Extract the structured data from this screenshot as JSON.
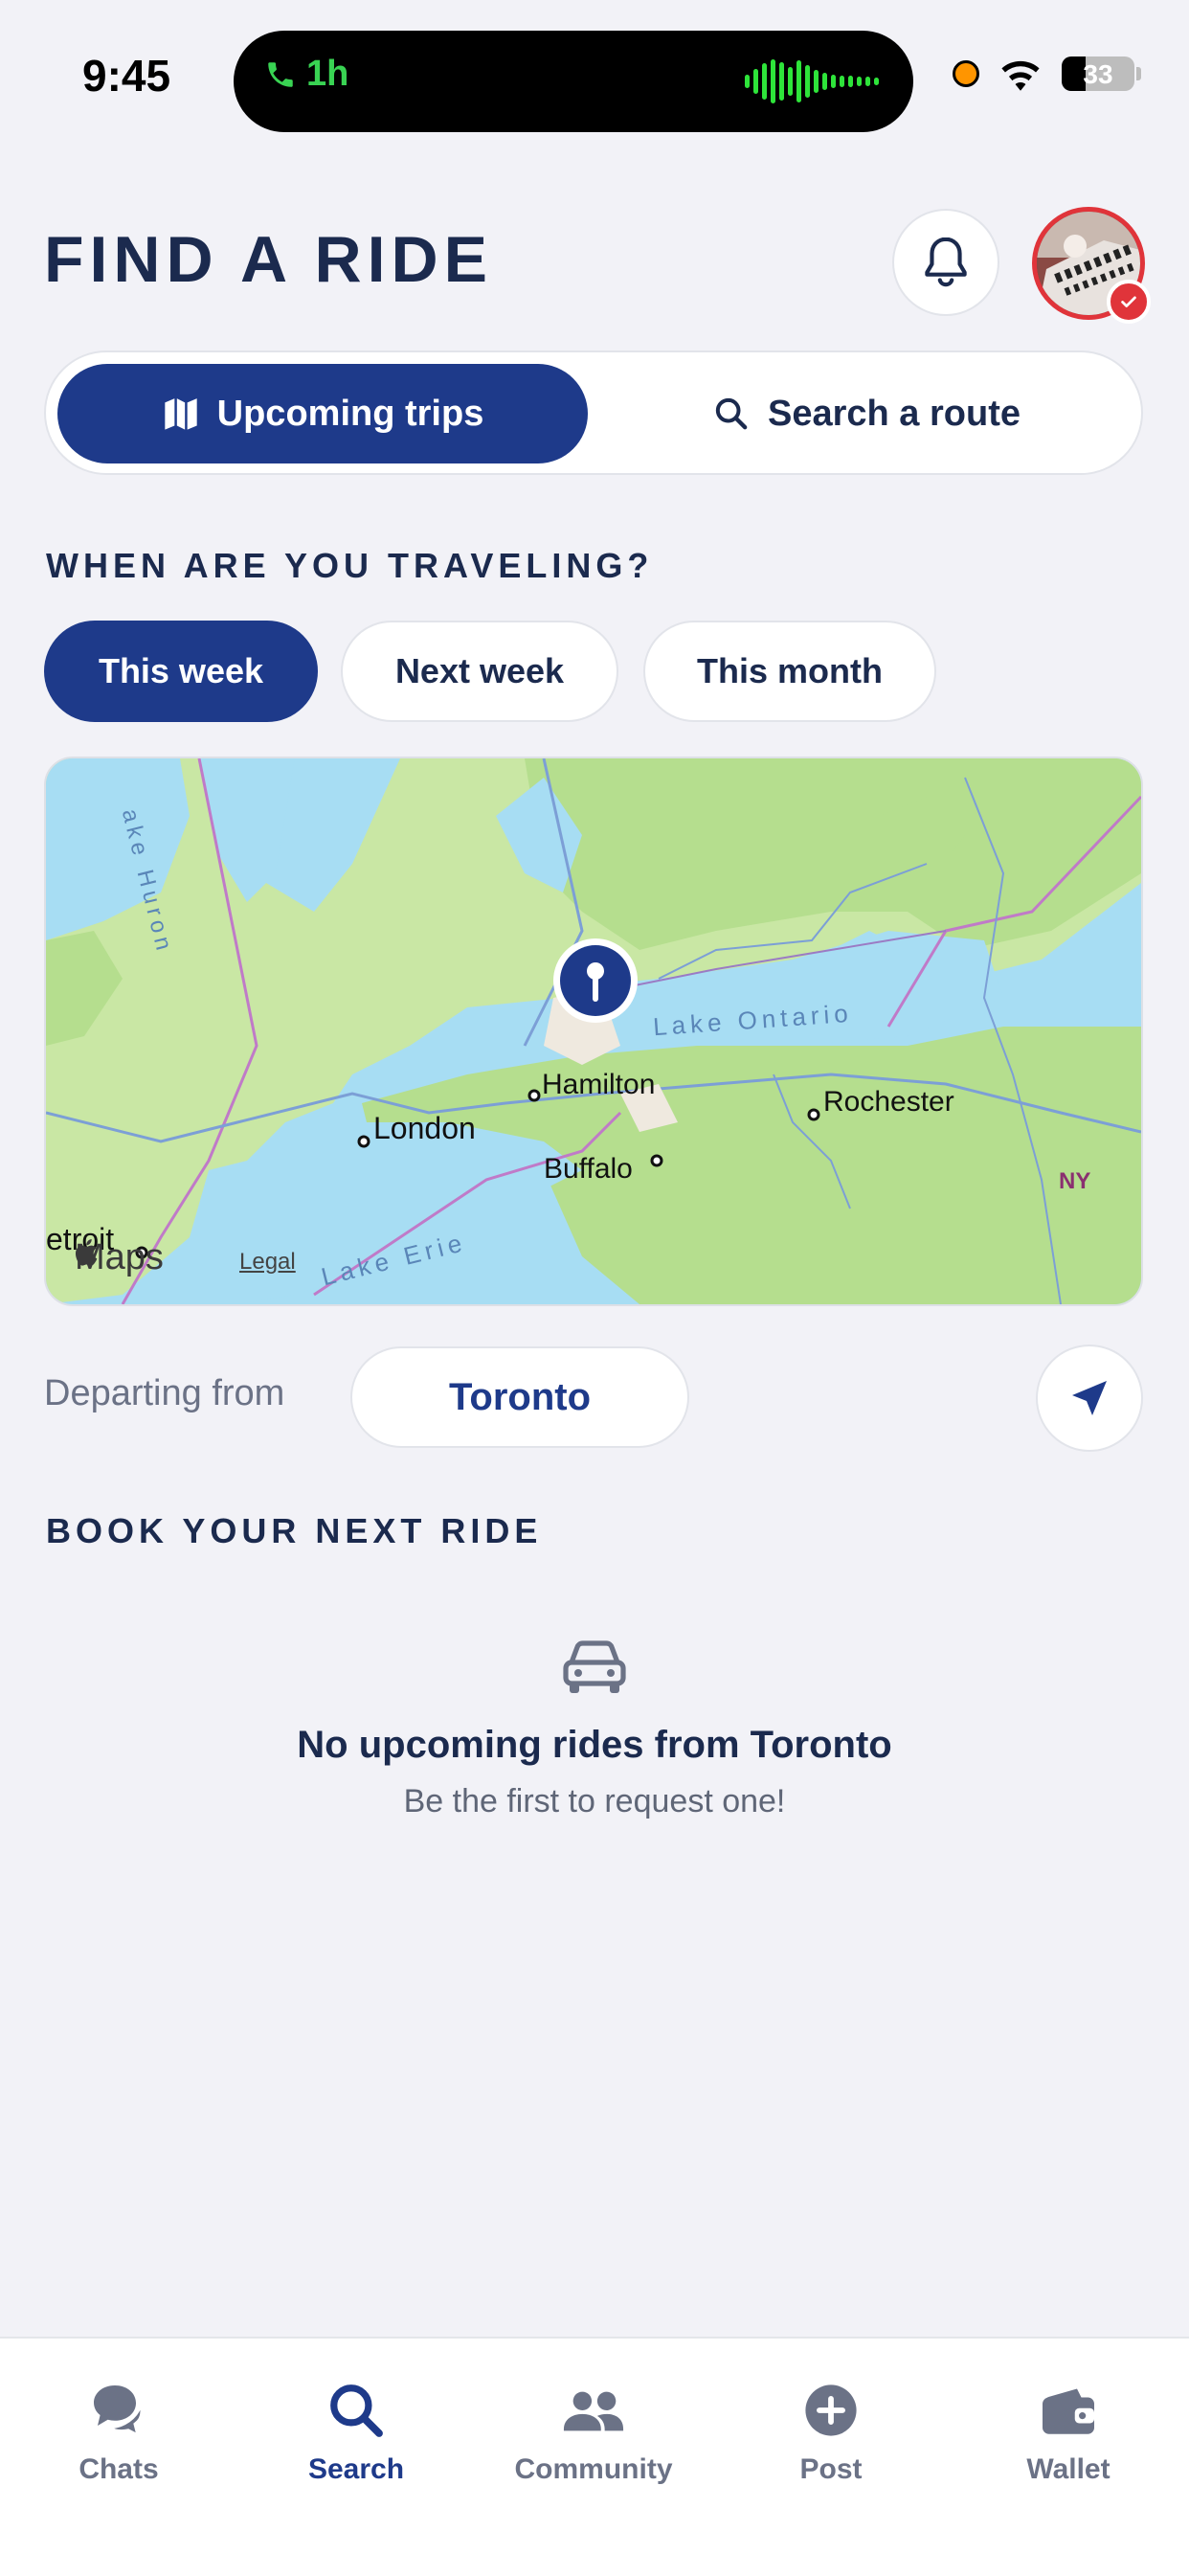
{
  "status_bar": {
    "time": "9:45",
    "call_duration": "1h",
    "battery": "33",
    "battery_level": 0.33
  },
  "header": {
    "title": "FIND A RIDE"
  },
  "segment": {
    "upcoming_label": "Upcoming trips",
    "search_label": "Search a route",
    "selected": "Upcoming trips"
  },
  "travel": {
    "label": "WHEN ARE YOU TRAVELING?",
    "options": [
      "This week",
      "Next week",
      "This month"
    ],
    "selected": "This week"
  },
  "map": {
    "cities": [
      "Hamilton",
      "London",
      "Rochester",
      "Buffalo",
      "etroit"
    ],
    "water_labels": [
      "Lake Ontario",
      "Lake Erie",
      "ake Huron"
    ],
    "state_label": "NY",
    "brand": "Maps",
    "legal": "Legal"
  },
  "departing": {
    "label": "Departing from",
    "city": "Toronto"
  },
  "book": {
    "label": "BOOK YOUR NEXT RIDE",
    "empty_title": "No upcoming rides from Toronto",
    "empty_subtitle": "Be the first to request one!"
  },
  "tabs": [
    {
      "label": "Chats",
      "icon": "chat-bubbles-icon"
    },
    {
      "label": "Search",
      "icon": "search-icon"
    },
    {
      "label": "Community",
      "icon": "people-icon"
    },
    {
      "label": "Post",
      "icon": "plus-circle-icon"
    },
    {
      "label": "Wallet",
      "icon": "wallet-icon"
    }
  ],
  "active_tab": "Search",
  "colors": {
    "primary": "#1e3a8a",
    "text": "#1b2a4e",
    "background": "#f2f2f7",
    "badge": "#e0343a"
  }
}
